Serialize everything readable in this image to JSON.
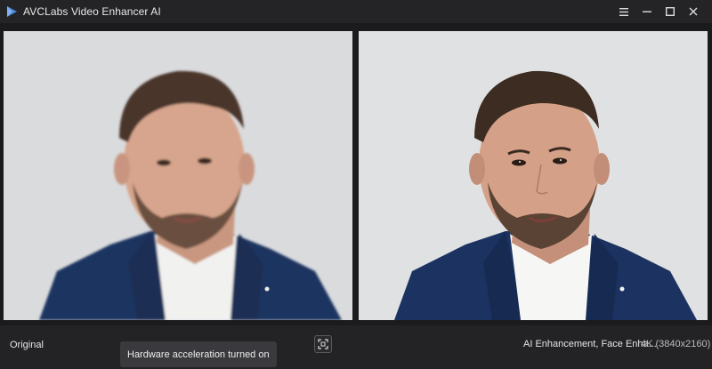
{
  "window": {
    "title": "AVCLabs Video Enhancer AI",
    "controls": [
      "menu-icon",
      "minimize-icon",
      "maximize-icon",
      "close-icon"
    ]
  },
  "preview": {
    "left_pane": {
      "image": "original-video-frame"
    },
    "right_pane": {
      "image": "enhanced-video-frame"
    }
  },
  "bottom_bar": {
    "original_label": "Original",
    "toast": "Hardware acceleration turned on",
    "compare_icon": "fullscreen-compare-icon",
    "enhancement_label": "AI Enhancement, Face Enha...",
    "resolution_label": "4K (3840x2160)"
  },
  "colors": {
    "titlebar": "#242427",
    "background": "#1b1b1d",
    "bottombar": "#232326",
    "toast": "#3a3a3e",
    "logo": "#4a8ad8"
  }
}
